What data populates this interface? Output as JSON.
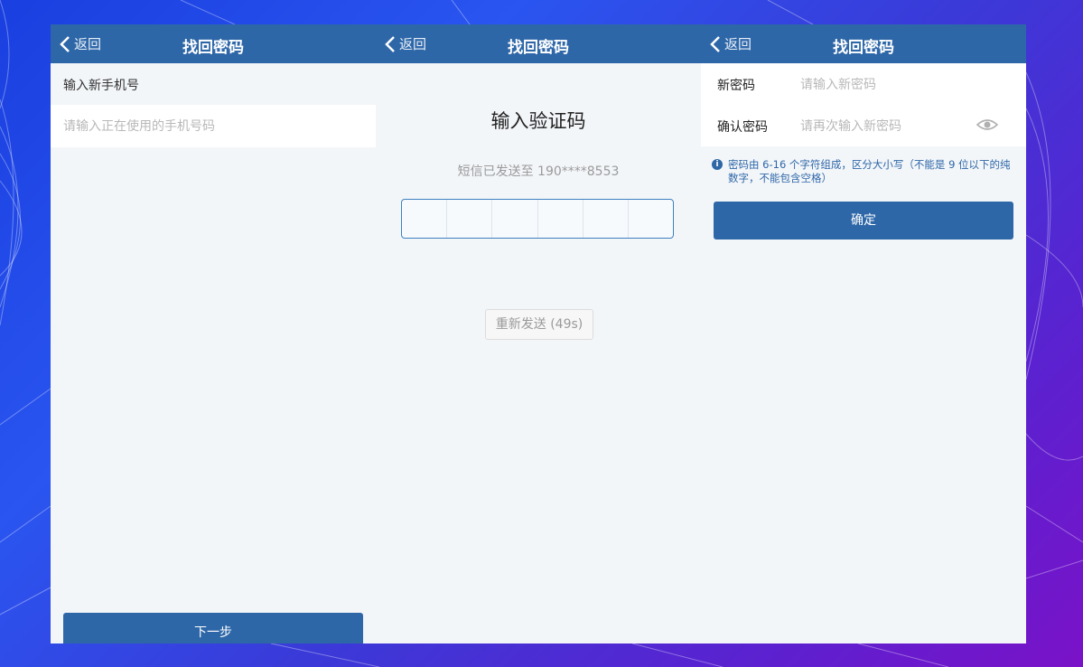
{
  "colors": {
    "primary": "#2e67a8",
    "page_bg": "#f3f6f9"
  },
  "panel1": {
    "back_label": "返回",
    "title": "找回密码",
    "field_label": "输入新手机号",
    "phone_placeholder": "请输入正在使用的手机号码",
    "next_label": "下一步"
  },
  "panel2": {
    "back_label": "返回",
    "title": "找回密码",
    "heading": "输入验证码",
    "sent_text": "短信已发送至 190****8553",
    "code_digits": [
      "",
      "",
      "",
      "",
      "",
      ""
    ],
    "resend_label": "重新发送 (49s)"
  },
  "panel3": {
    "back_label": "返回",
    "title": "找回密码",
    "new_password_label": "新密码",
    "new_password_placeholder": "请输入新密码",
    "confirm_label": "确认密码",
    "confirm_placeholder": "请再次输入新密码",
    "eye_icon": "eye-icon",
    "hint": "密码由 6-16 个字符组成，区分大小写（不能是 9 位以下的纯数字，不能包含空格）",
    "confirm_button": "确定"
  }
}
